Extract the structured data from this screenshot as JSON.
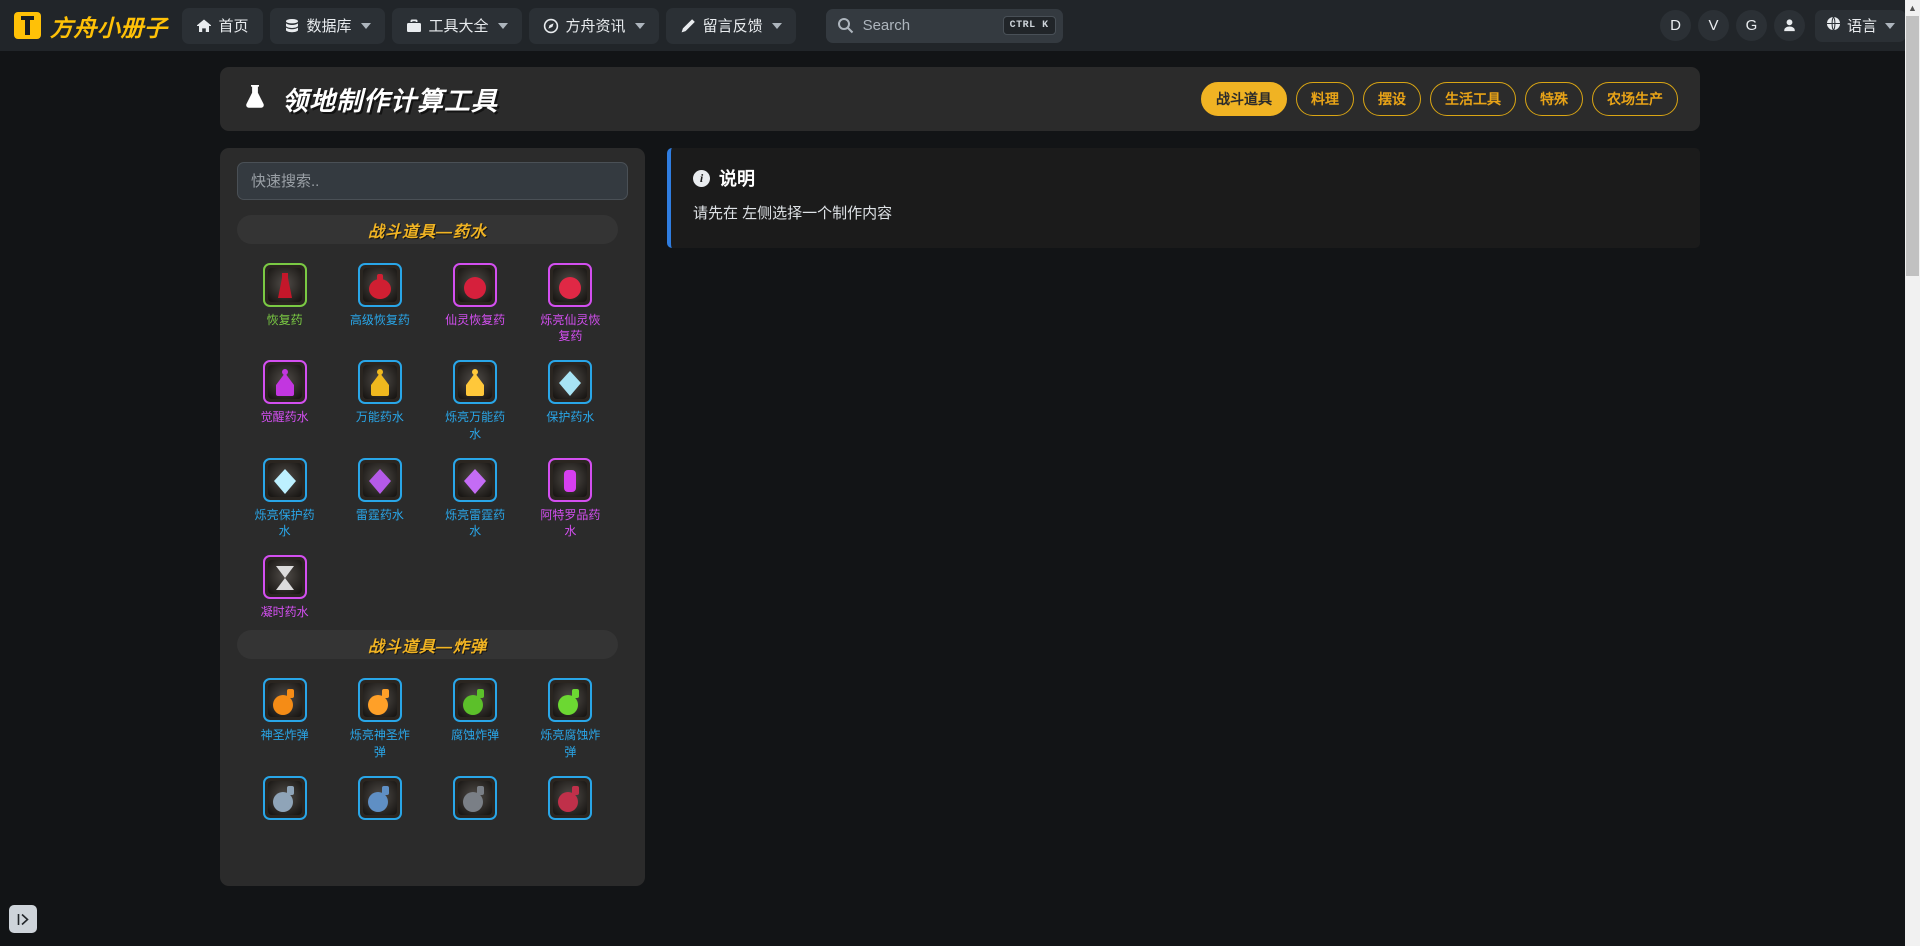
{
  "navbar": {
    "brand": "方舟小册子",
    "items": [
      {
        "label": "首页",
        "icon": "home-icon",
        "caret": false
      },
      {
        "label": "数据库",
        "icon": "database-icon",
        "caret": true
      },
      {
        "label": "工具大全",
        "icon": "toolbox-icon",
        "caret": true
      },
      {
        "label": "方舟资讯",
        "icon": "compass-icon",
        "caret": true
      },
      {
        "label": "留言反馈",
        "icon": "pencil-icon",
        "caret": true
      }
    ],
    "search": {
      "placeholder": "Search",
      "shortcut": "CTRL K"
    },
    "right": {
      "avatars": [
        "D",
        "V",
        "G"
      ],
      "user_icon": "user-icon",
      "language_label": "语言"
    }
  },
  "page": {
    "title": "领地制作计算工具",
    "title_icon": "flask-icon",
    "category_tabs": [
      {
        "label": "战斗道具",
        "active": true
      },
      {
        "label": "料理",
        "active": false
      },
      {
        "label": "摆设",
        "active": false
      },
      {
        "label": "生活工具",
        "active": false
      },
      {
        "label": "特殊",
        "active": false
      },
      {
        "label": "农场生产",
        "active": false
      }
    ]
  },
  "left_panel": {
    "search_placeholder": "快速搜索..",
    "sections": [
      {
        "title": "战斗道具—药水",
        "items": [
          {
            "name": "恢复药",
            "rarity": "green",
            "color": "#7ac943",
            "fluid": "#c4172a",
            "shape": "vial"
          },
          {
            "name": "高级恢复药",
            "rarity": "blue",
            "color": "#29a6e8",
            "fluid": "#d01f32",
            "shape": "flask"
          },
          {
            "name": "仙灵恢复药",
            "rarity": "purple",
            "color": "#d34ff0",
            "fluid": "#d6203c",
            "shape": "orb"
          },
          {
            "name": "烁亮仙灵恢复药",
            "rarity": "purple",
            "color": "#d34ff0",
            "fluid": "#e02845",
            "shape": "orb"
          },
          {
            "name": "觉醒药水",
            "rarity": "purple",
            "color": "#d34ff0",
            "fluid": "#c236e0",
            "shape": "bell"
          },
          {
            "name": "万能药水",
            "rarity": "blue",
            "color": "#29a6e8",
            "fluid": "#f0b81e",
            "shape": "bell"
          },
          {
            "name": "烁亮万能药水",
            "rarity": "blue",
            "color": "#29a6e8",
            "fluid": "#ffc83a",
            "shape": "bell"
          },
          {
            "name": "保护药水",
            "rarity": "blue",
            "color": "#29a6e8",
            "fluid": "#a8e4f5",
            "shape": "drop"
          },
          {
            "name": "烁亮保护药水",
            "rarity": "blue",
            "color": "#29a6e8",
            "fluid": "#bdf0ff",
            "shape": "drop"
          },
          {
            "name": "雷霆药水",
            "rarity": "blue",
            "color": "#29a6e8",
            "fluid": "#b45ae8",
            "shape": "drop"
          },
          {
            "name": "烁亮雷霆药水",
            "rarity": "blue",
            "color": "#29a6e8",
            "fluid": "#c46cf5",
            "shape": "drop"
          },
          {
            "name": "阿特罗品药水",
            "rarity": "purple",
            "color": "#d34ff0",
            "fluid": "#d63ff0",
            "shape": "tube"
          },
          {
            "name": "凝时药水",
            "rarity": "purple",
            "color": "#d34ff0",
            "fluid": "#dcdcdc",
            "shape": "hourglass"
          }
        ]
      },
      {
        "title": "战斗道具—炸弹",
        "items": [
          {
            "name": "神圣炸弹",
            "rarity": "blue",
            "color": "#29a6e8",
            "fluid": "#f58c16",
            "shape": "bomb"
          },
          {
            "name": "烁亮神圣炸弹",
            "rarity": "blue",
            "color": "#29a6e8",
            "fluid": "#ffa028",
            "shape": "bomb"
          },
          {
            "name": "腐蚀炸弹",
            "rarity": "blue",
            "color": "#29a6e8",
            "fluid": "#5cc02a",
            "shape": "bomb"
          },
          {
            "name": "烁亮腐蚀炸弹",
            "rarity": "blue",
            "color": "#29a6e8",
            "fluid": "#6cd832",
            "shape": "bomb"
          },
          {
            "name": "",
            "rarity": "blue",
            "color": "#29a6e8",
            "fluid": "#8fa4b8",
            "shape": "bomb"
          },
          {
            "name": "",
            "rarity": "blue",
            "color": "#29a6e8",
            "fluid": "#5f8fc4",
            "shape": "bomb"
          },
          {
            "name": "",
            "rarity": "blue",
            "color": "#29a6e8",
            "fluid": "#7a7f86",
            "shape": "bomb"
          },
          {
            "name": "",
            "rarity": "blue",
            "color": "#29a6e8",
            "fluid": "#c0304a",
            "shape": "bomb"
          }
        ]
      }
    ]
  },
  "right_panel": {
    "info_title": "说明",
    "info_icon": "info-circle-icon",
    "info_text": "请先在 左侧选择一个制作内容"
  },
  "footer": {
    "toggle_icon": "sidebar-expand-icon"
  }
}
